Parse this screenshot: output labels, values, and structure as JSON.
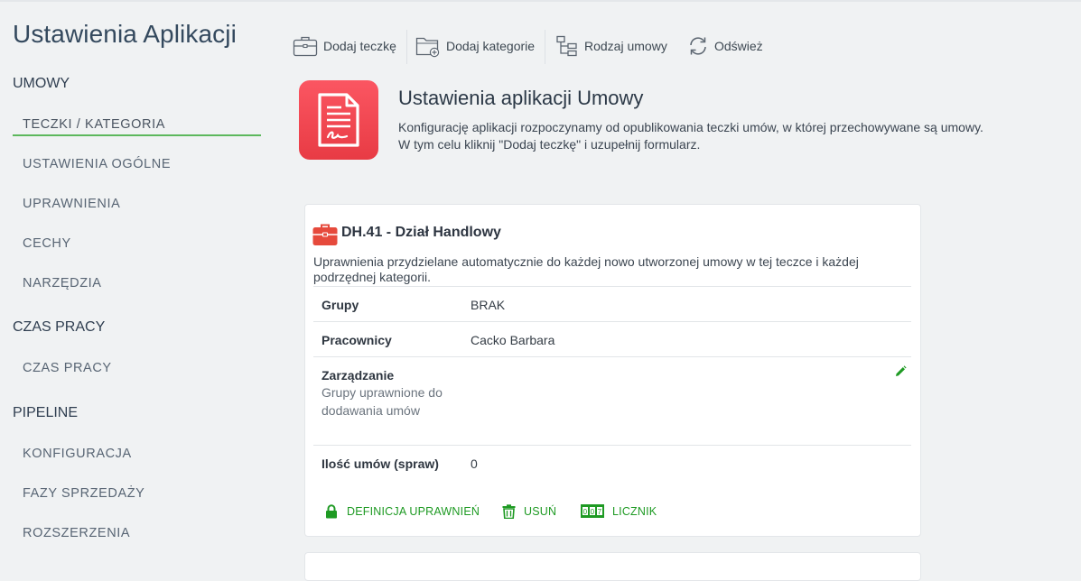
{
  "app": {
    "title": "Ustawienia Aplikacji"
  },
  "sidebar": {
    "sections": [
      {
        "label": "UMOWY",
        "items": [
          "TECZKI / KATEGORIA",
          "USTAWIENIA OGÓLNE",
          "UPRAWNIENIA",
          "CECHY",
          "NARZĘDZIA"
        ]
      },
      {
        "label": "CZAS PRACY",
        "items": [
          "CZAS PRACY"
        ]
      },
      {
        "label": "PIPELINE",
        "items": [
          "KONFIGURACJA",
          "FAZY SPRZEDAŻY",
          "ROZSZERZENIA"
        ]
      }
    ],
    "active_item": "TECZKI / KATEGORIA"
  },
  "toolbar": {
    "add_folder": "Dodaj teczkę",
    "add_category": "Dodaj kategorie",
    "contract_type": "Rodzaj umowy",
    "refresh": "Odśwież"
  },
  "header": {
    "title": "Ustawienia aplikacji Umowy",
    "description_line1": "Konfigurację aplikacji rozpoczynamy od opublikowania teczki umów, w której przechowywane są umowy.",
    "description_line2": "W tym celu kliknij \"Dodaj teczkę\" i uzupełnij formularz."
  },
  "folder_card": {
    "title": "DH.41 - Dział Handlowy",
    "description": "Uprawnienia przydzielane automatycznie do każdej nowo utworzonej umowy w tej teczce i każdej podrzędnej kategorii.",
    "rows": {
      "groups": {
        "label": "Grupy",
        "value": "BRAK"
      },
      "employees": {
        "label": "Pracownicy",
        "value": "Cacko Barbara"
      },
      "management": {
        "label": "Zarządzanie",
        "sublabel": "Grupy uprawnione do dodawania umów"
      },
      "count": {
        "label": "Ilość umów (spraw)",
        "value": "0"
      }
    },
    "actions": {
      "permissions": "DEFINICJA UPRAWNIEŃ",
      "delete": "USUŃ",
      "counter": "LICZNIK"
    }
  },
  "colors": {
    "accent_green": "#1e9a23",
    "active_underline": "#5cb85c",
    "app_icon_red": "#f04a52",
    "folder_icon_red": "#e64a3c"
  },
  "icons": {
    "add_folder": "briefcase-icon",
    "add_category": "folder-plus-icon",
    "contract_type": "tree-icon",
    "refresh": "refresh-icon",
    "app": "contract-document-icon",
    "card": "briefcase-icon",
    "edit": "pencil-icon",
    "permissions": "lock-icon",
    "delete": "trash-icon",
    "counter": "counter-icon"
  }
}
